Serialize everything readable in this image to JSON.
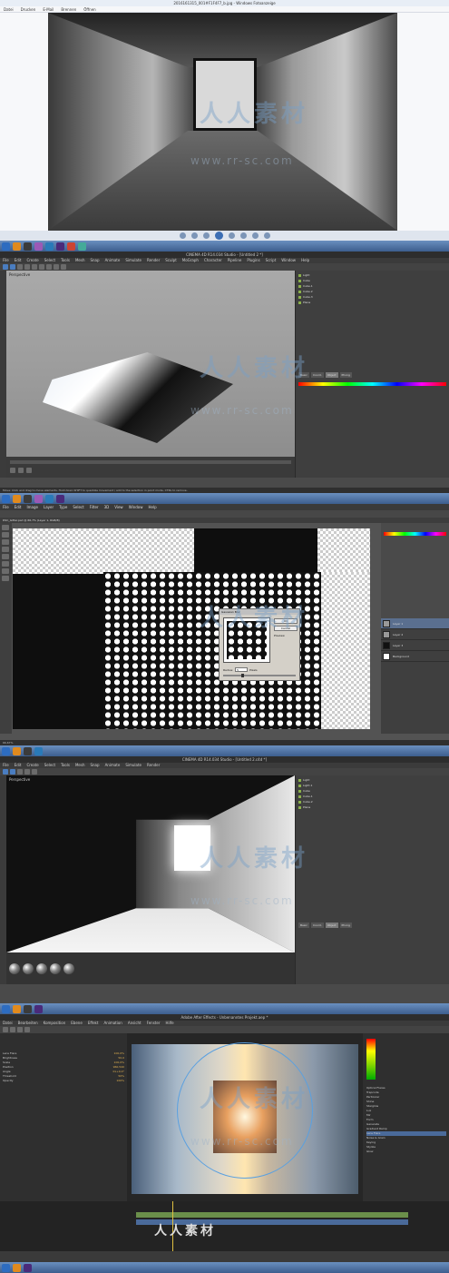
{
  "photo_viewer": {
    "title": "2016161315_001#F1F4F7_b.jpg - Windows Fotoanzeige",
    "menu": [
      "Datei",
      "Drucken",
      "E-Mail",
      "Brennen",
      "Öffnen"
    ]
  },
  "cinema4d_a": {
    "title": "CINEMA 4D R14.034 Studio - [Untitled 2 *]",
    "menu": [
      "File",
      "Edit",
      "Create",
      "Select",
      "Tools",
      "Mesh",
      "Snap",
      "Animate",
      "Simulate",
      "Render",
      "Sculpt",
      "MoGraph",
      "Character",
      "Pipeline",
      "Plugins",
      "Script",
      "Window",
      "Help"
    ],
    "viewport_label": "Perspective",
    "objects": [
      "Light",
      "Cube",
      "Cube.1",
      "Cube.2",
      "Cube.3",
      "Plane"
    ],
    "attr_tabs": [
      "Basic",
      "Coord.",
      "Object",
      "Phong"
    ],
    "status": "Move: Click and drag to move elements. Hold down SHIFT to quantize movement / add to the selection in point mode, CTRL to remove."
  },
  "photoshop": {
    "menu": [
      "File",
      "Edit",
      "Image",
      "Layer",
      "Type",
      "Select",
      "Filter",
      "3D",
      "View",
      "Window",
      "Help"
    ],
    "tab": "DSC_Gitter.psd @ 66,7% (Layer 1, RGB/8)",
    "dialog": {
      "title": "Gaussian Blur",
      "ok": "OK",
      "cancel": "Cancel",
      "preview": "Preview",
      "radius_label": "Radius:",
      "radius_value": "5",
      "unit": "Pixels"
    },
    "layers": [
      "Layer 1",
      "Layer 2",
      "Layer 3",
      "Background"
    ],
    "zoom": "66,67%"
  },
  "cinema4d_b": {
    "title": "CINEMA 4D R14.034 Studio - [Untitled 2.c4d *]",
    "viewport_label": "Perspective",
    "objects": [
      "Light",
      "Light.1",
      "Cube",
      "Cube.1",
      "Cube.2",
      "Plane"
    ],
    "attr_tabs": [
      "Basic",
      "Coord.",
      "Object",
      "Phong"
    ]
  },
  "after_effects": {
    "title": "Adobe After Effects - Unbenanntes Projekt.aep *",
    "menu": [
      "Datei",
      "Bearbeiten",
      "Komposition",
      "Ebene",
      "Effekt",
      "Animation",
      "Ansicht",
      "Fenster",
      "Hilfe"
    ],
    "props": [
      {
        "label": "Lens Flare",
        "value": "100,0%"
      },
      {
        "label": "Brightness",
        "value": "50,0"
      },
      {
        "label": "Scale",
        "value": "100,0%"
      },
      {
        "label": "Position",
        "value": "960,540"
      },
      {
        "label": "Angle",
        "value": "0x+0,0°"
      },
      {
        "label": "Threshold",
        "value": "50%"
      },
      {
        "label": "Opacity",
        "value": "100%"
      }
    ],
    "effects": [
      "Optical Flares",
      "Trapcode",
      "Particular",
      "Shine",
      "Starglow",
      "Lux",
      "Mir",
      "Form",
      "Generate",
      "Gradient Ramp",
      "Lens Flare",
      "Noise & Grain",
      "Keying",
      "Stylize",
      "Glow"
    ],
    "selected_effect_index": 10
  },
  "watermark": {
    "cn": "人人素材",
    "url": "www.rr-sc.com"
  },
  "colors": {
    "c4d_bg": "#4a4a4a",
    "ps_bg": "#535353",
    "ae_bg": "#3a3a3a",
    "taskbar": "#3c5e8e"
  }
}
